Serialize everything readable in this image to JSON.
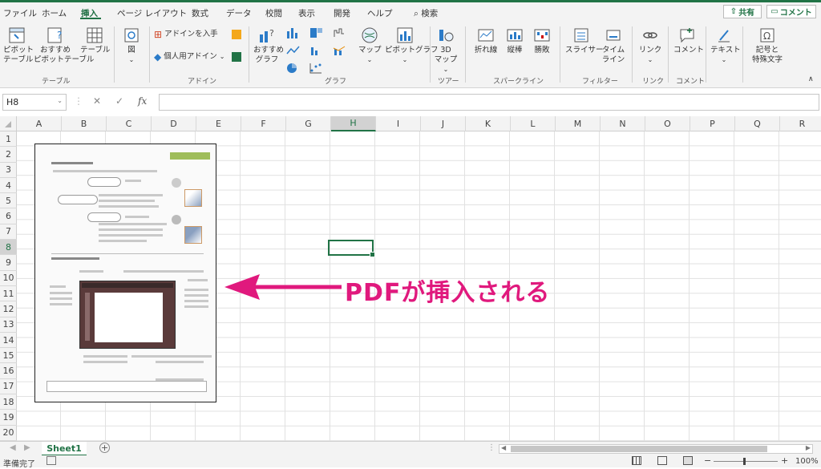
{
  "tabs": [
    "ファイル",
    "ホーム",
    "挿入",
    "ページ レイアウト",
    "数式",
    "データ",
    "校閲",
    "表示",
    "開発",
    "ヘルプ"
  ],
  "active_tab": "挿入",
  "search_label": "検索",
  "share_label": "共有",
  "comment_label": "コメント",
  "ribbon": {
    "pivot_table": "ピボット\nテーブル",
    "recommended_pivot": "おすすめ\nピボットテーブル",
    "table": "テーブル",
    "group_table": "テーブル",
    "illustration": "図",
    "get_addins": "アドインを入手",
    "my_addins": "個人用アドイン",
    "group_addins": "アドイン",
    "recommended_charts": "おすすめ\nグラフ",
    "maps": "マップ",
    "pivot_chart": "ピボットグラフ",
    "group_charts": "グラフ",
    "map3d": "3D\nマップ",
    "group_tours": "ツアー",
    "line": "折れ線",
    "column": "縦棒",
    "winloss": "勝敗",
    "group_sparklines": "スパークライン",
    "slicer": "スライサー",
    "timeline": "タイム\nライン",
    "group_filters": "フィルター",
    "link": "リンク",
    "group_links": "リンク",
    "comment": "コメント",
    "group_comments": "コメント",
    "text": "テキスト",
    "symbols": "記号と\n特殊文字"
  },
  "name_box": "H8",
  "fx_label": "fx",
  "columns": [
    "A",
    "B",
    "C",
    "D",
    "E",
    "F",
    "G",
    "H",
    "I",
    "J",
    "K",
    "L",
    "M",
    "N",
    "O",
    "P",
    "Q",
    "R"
  ],
  "rows": [
    "1",
    "2",
    "3",
    "4",
    "5",
    "6",
    "7",
    "8",
    "9",
    "10",
    "11",
    "12",
    "13",
    "14",
    "15",
    "16",
    "17",
    "18",
    "19",
    "20"
  ],
  "selected_column": "H",
  "selected_row": "8",
  "callout_text": "PDFが挿入される",
  "sheet_name": "Sheet1",
  "status_text": "準備完了",
  "zoom": "100%",
  "colors": {
    "accent": "#217346",
    "callout": "#e0197d"
  }
}
